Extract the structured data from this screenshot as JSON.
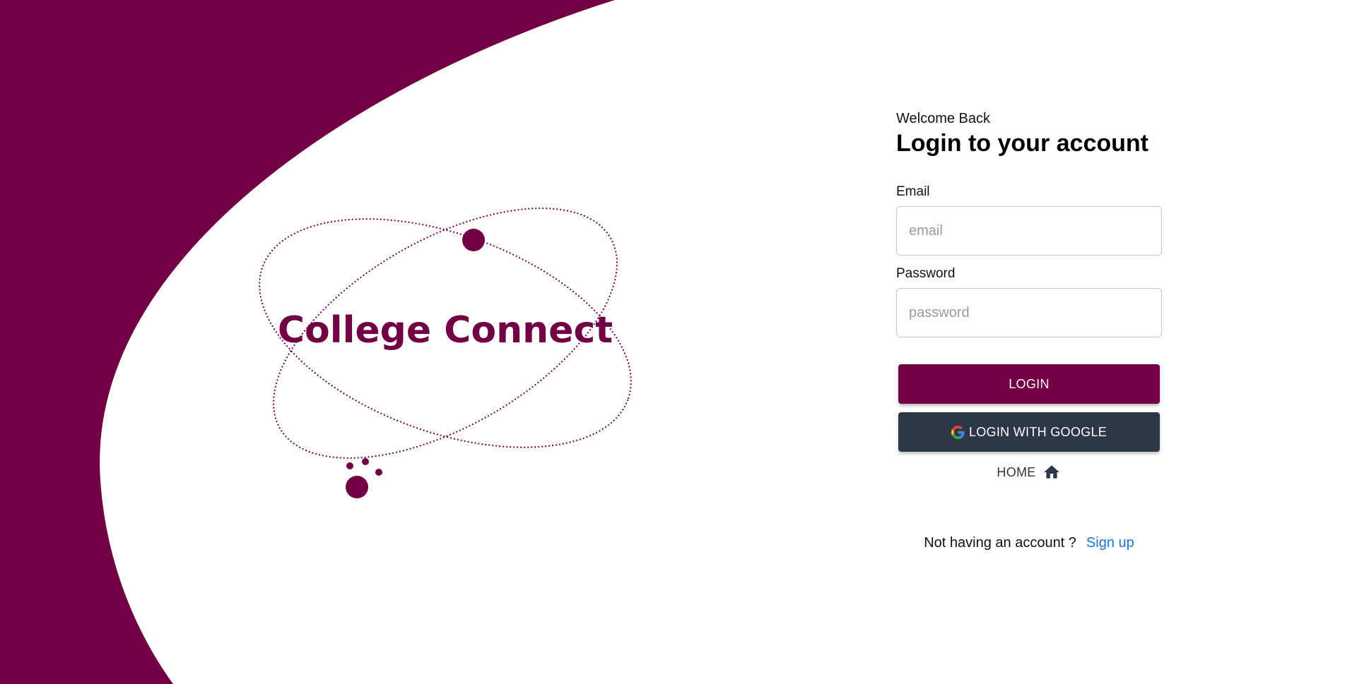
{
  "colors": {
    "brand": "#700043",
    "dark": "#2e3748",
    "link": "#1976d2"
  },
  "logo": {
    "text": "College Connect"
  },
  "login": {
    "welcome": "Welcome Back",
    "heading": "Login to your account",
    "email_label": "Email",
    "email_placeholder": "email",
    "email_value": "",
    "password_label": "Password",
    "password_placeholder": "password",
    "password_value": "",
    "login_button": "LOGIN",
    "google_button": "LOGIN WITH GOOGLE",
    "google_icon": "google-icon",
    "home_link": "HOME",
    "home_icon": "home-icon",
    "signup_prompt": "Not having an account ?",
    "signup_link": "Sign up"
  }
}
